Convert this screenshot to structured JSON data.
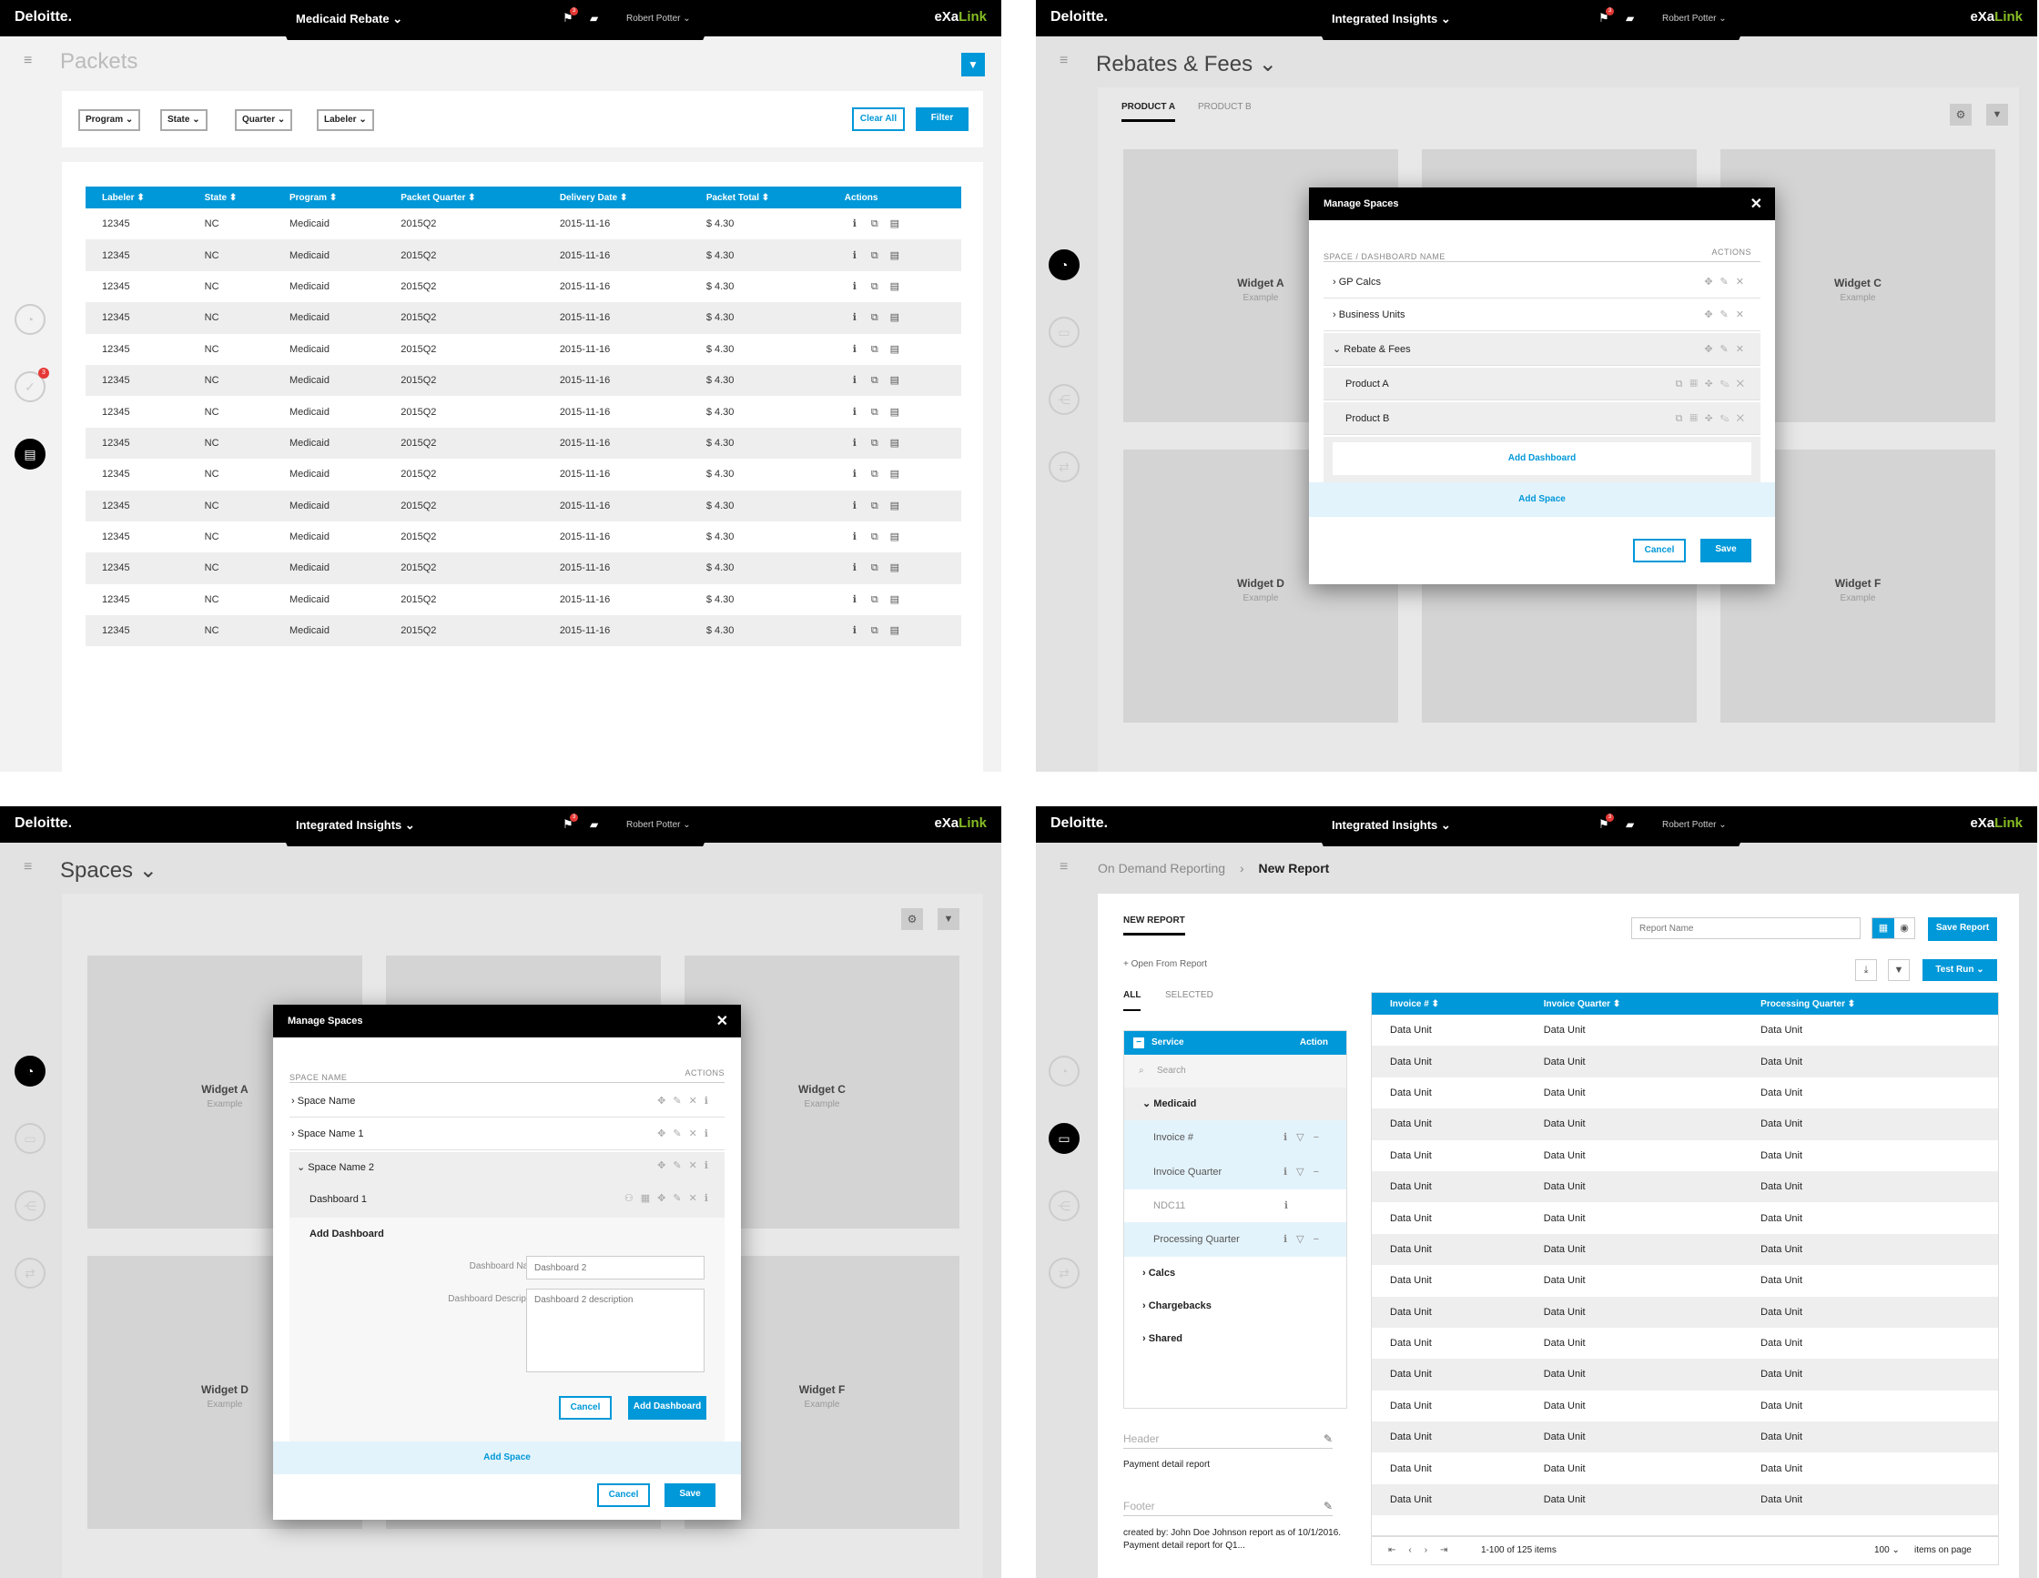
{
  "common": {
    "brand": "Deloitte.",
    "app_brand_a": "eXa",
    "app_brand_b": "Link",
    "notif_count": "3",
    "user": "Robert Potter ⌄"
  },
  "q1": {
    "tab_title": "Medicaid Rebate ⌄",
    "page_title": "Packets",
    "filters": [
      "Program",
      "State",
      "Quarter",
      "Labeler"
    ],
    "clear_all": "Clear All",
    "filter": "Filter",
    "columns": [
      "Labeler ⬍",
      "State ⬍",
      "Program ⬍",
      "Packet Quarter ⬍",
      "Delivery Date ⬍",
      "Packet Total ⬍",
      "Actions"
    ],
    "rows": [
      [
        "12345",
        "NC",
        "Medicaid",
        "2015Q2",
        "2015-11-16",
        "$ 4.30"
      ],
      [
        "12345",
        "NC",
        "Medicaid",
        "2015Q2",
        "2015-11-16",
        "$ 4.30"
      ],
      [
        "12345",
        "NC",
        "Medicaid",
        "2015Q2",
        "2015-11-16",
        "$ 4.30"
      ],
      [
        "12345",
        "NC",
        "Medicaid",
        "2015Q2",
        "2015-11-16",
        "$ 4.30"
      ],
      [
        "12345",
        "NC",
        "Medicaid",
        "2015Q2",
        "2015-11-16",
        "$ 4.30"
      ],
      [
        "12345",
        "NC",
        "Medicaid",
        "2015Q2",
        "2015-11-16",
        "$ 4.30"
      ],
      [
        "12345",
        "NC",
        "Medicaid",
        "2015Q2",
        "2015-11-16",
        "$ 4.30"
      ],
      [
        "12345",
        "NC",
        "Medicaid",
        "2015Q2",
        "2015-11-16",
        "$ 4.30"
      ],
      [
        "12345",
        "NC",
        "Medicaid",
        "2015Q2",
        "2015-11-16",
        "$ 4.30"
      ],
      [
        "12345",
        "NC",
        "Medicaid",
        "2015Q2",
        "2015-11-16",
        "$ 4.30"
      ],
      [
        "12345",
        "NC",
        "Medicaid",
        "2015Q2",
        "2015-11-16",
        "$ 4.30"
      ],
      [
        "12345",
        "NC",
        "Medicaid",
        "2015Q2",
        "2015-11-16",
        "$ 4.30"
      ],
      [
        "12345",
        "NC",
        "Medicaid",
        "2015Q2",
        "2015-11-16",
        "$ 4.30"
      ],
      [
        "12345",
        "NC",
        "Medicaid",
        "2015Q2",
        "2015-11-16",
        "$ 4.30"
      ]
    ]
  },
  "q2": {
    "tab_title": "Integrated Insights ⌄",
    "page_title": "Rebates & Fees ⌄",
    "tabs": [
      "PRODUCT A",
      "PRODUCT B"
    ],
    "widgets": [
      "Widget A",
      "Widget C",
      "Widget D",
      "Widget F"
    ],
    "widget_sub": "Example",
    "modal_title": "Manage Spaces",
    "col_name": "SPACE / DASHBOARD NAME",
    "col_actions": "ACTIONS",
    "items": [
      "GP Calcs",
      "Business Units",
      "Rebate & Fees",
      "Product A",
      "Product B"
    ],
    "add_dashboard": "Add Dashboard",
    "add_space": "Add Space",
    "cancel": "Cancel",
    "save": "Save"
  },
  "q3": {
    "tab_title": "Integrated Insights ⌄",
    "page_title": "Spaces ⌄",
    "widgets": [
      "Widget A",
      "Widget C",
      "Widget D",
      "Widget F"
    ],
    "widget_sub": "Example",
    "modal_title": "Manage Spaces",
    "col_name": "SPACE NAME",
    "col_actions": "ACTIONS",
    "items": [
      "Space Name",
      "Space Name 1",
      "Space Name 2",
      "Dashboard 1"
    ],
    "add_dashboard_heading": "Add Dashboard",
    "dash_name_label": "Dashboard Name",
    "dash_name_placeholder": "Dashboard 2",
    "dash_desc_label": "Dashboard Description",
    "dash_desc_placeholder": "Dashboard 2 description",
    "cancel": "Cancel",
    "add_dashboard_btn": "Add Dashboard",
    "add_space": "Add Space",
    "save": "Save"
  },
  "q4": {
    "tab_title": "Integrated Insights ⌄",
    "breadcrumb_parent": "On Demand Reporting",
    "breadcrumb_current": "New Report",
    "tab": "NEW REPORT",
    "report_name_placeholder": "Report Name",
    "save_report": "Save Report",
    "open_from": "+ Open From Report",
    "test_run": "Test Run",
    "seg": [
      "ALL",
      "SELECTED"
    ],
    "tree_head": "Service",
    "tree_action": "Action",
    "search_placeholder": "Search",
    "tree": [
      "Medicaid",
      "Invoice #",
      "Invoice Quarter",
      "NDC11",
      "Processing Quarter",
      "Calcs",
      "Chargebacks",
      "Shared"
    ],
    "header_label": "Header",
    "header_value": "Payment detail report",
    "footer_label": "Footer",
    "footer_value": "created by: John Doe Johnson report as of 10/1/2016. Payment detail report for Q1...",
    "columns": [
      "Invoice # ⬍",
      "Invoice Quarter ⬍",
      "Processing Quarter ⬍"
    ],
    "cell": "Data Unit",
    "row_count": 16,
    "pager": "1-100 of 125 items",
    "page_size": "100 ⌄",
    "items_label": "items on page"
  }
}
